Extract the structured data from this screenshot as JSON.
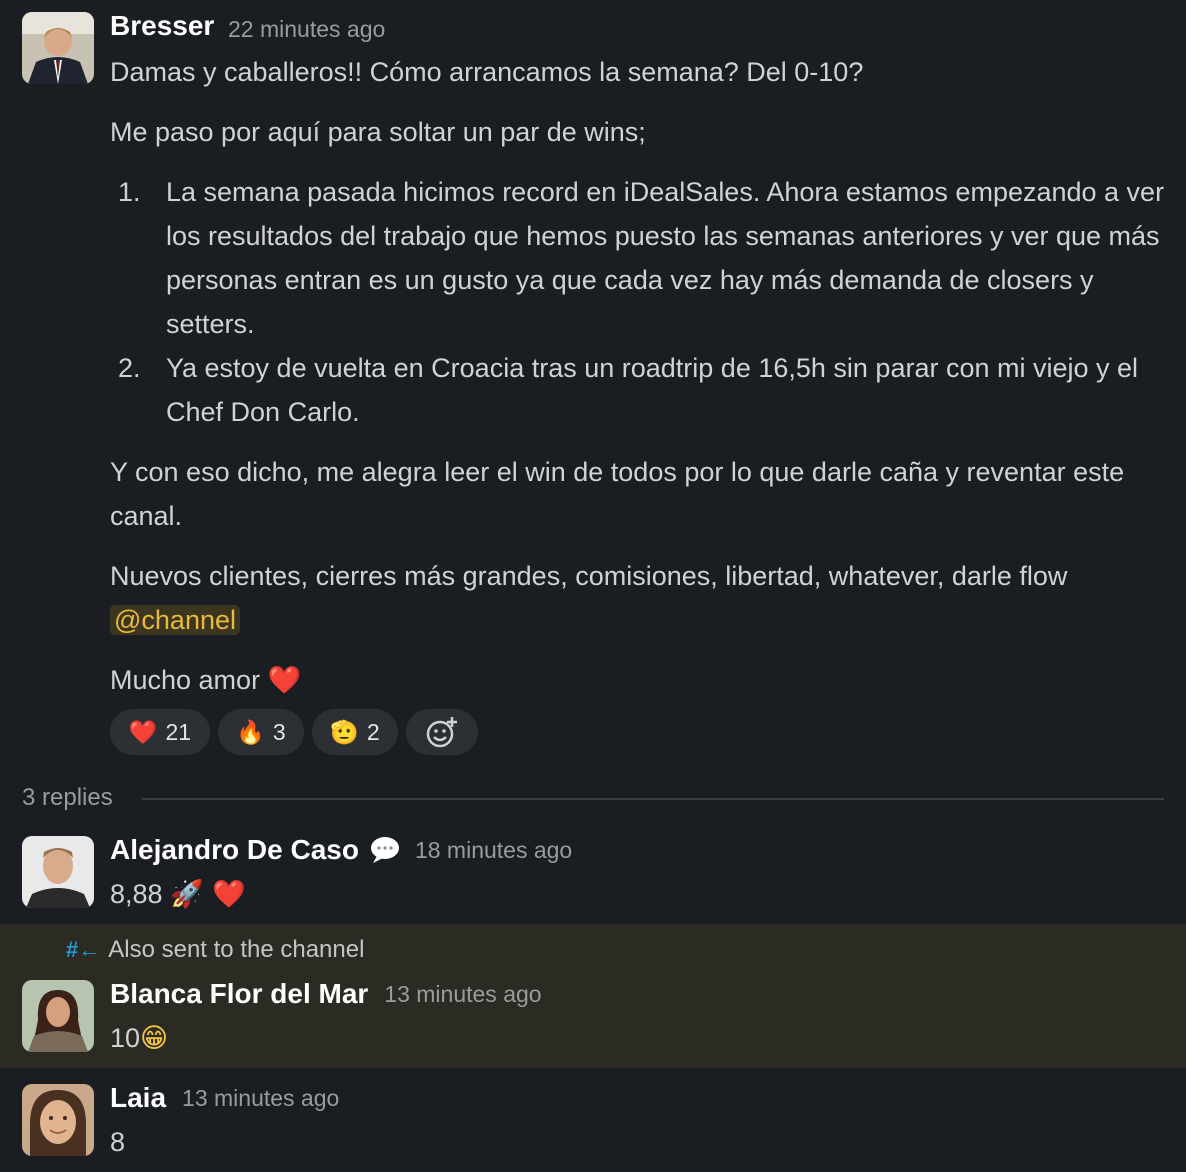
{
  "thread": {
    "root": {
      "author": "Bresser",
      "time": "22 minutes ago",
      "line1": "Damas y caballeros!! Cómo arrancamos la semana? Del 0-10?",
      "line2": "Me paso por aquí para soltar un par de wins;",
      "list": [
        {
          "num": "1.",
          "text": "La semana pasada hicimos record en iDealSales. Ahora estamos empezando a ver los resultados del trabajo que hemos puesto las semanas anteriores y ver que más personas entran es un gusto ya que cada vez hay más demanda de closers y setters."
        },
        {
          "num": "2.",
          "text": "Ya estoy de vuelta en Croacia tras un roadtrip de 16,5h sin parar con mi viejo y el Chef Don Carlo."
        }
      ],
      "para3": "Y con eso dicho, me alegra leer el win de todos por lo que darle caña y reventar este canal.",
      "para4": "Nuevos clientes, cierres más grandes, comisiones, libertad, whatever, darle flow",
      "mention": "@channel",
      "closing": "Mucho amor",
      "closing_emoji": "❤️",
      "reactions": [
        {
          "emoji": "❤️",
          "count": "21"
        },
        {
          "emoji": "🔥",
          "count": "3"
        },
        {
          "emoji": "🫡",
          "count": "2"
        }
      ],
      "add_reaction_icon": "add-emoji-icon"
    },
    "replies_label": "3 replies",
    "replies": [
      {
        "author": "Alejandro De Caso",
        "badge_icon": "speech-bubble-icon",
        "time": "18 minutes ago",
        "text": "8,88",
        "emojis": "🚀 ❤️"
      },
      {
        "also_sent_label": "Also sent to the channel",
        "author": "Blanca Flor del Mar",
        "time": "13 minutes ago",
        "text": "10",
        "emojis": "😁"
      },
      {
        "author": "Laia",
        "time": "13 minutes ago",
        "text": "8"
      }
    ]
  },
  "colors": {
    "background": "#1a1d21",
    "highlight": "#2b2a23",
    "mention_bg": "#3c3621",
    "mention_fg": "#e8b93a",
    "link_blue": "#1d9bd1"
  }
}
